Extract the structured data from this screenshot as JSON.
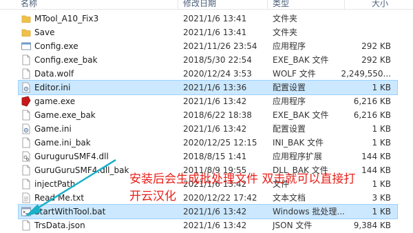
{
  "columns": {
    "name": "名称",
    "date": "修改日期",
    "type": "类型",
    "size": "大小"
  },
  "files": [
    {
      "name": "MTool_A10_Fix3",
      "date": "2021/1/6 13:41",
      "type": "文件夹",
      "size": "",
      "icon": "folder-icon"
    },
    {
      "name": "Save",
      "date": "2021/1/6 13:41",
      "type": "文件夹",
      "size": "",
      "icon": "folder-icon"
    },
    {
      "name": "Config.exe",
      "date": "2021/11/26 23:54",
      "type": "应用程序",
      "size": "292 KB",
      "icon": "window-exe-icon"
    },
    {
      "name": "Config.exe_bak",
      "date": "2018/5/30 22:54",
      "type": "EXE_BAK 文件",
      "size": "292 KB",
      "icon": "file-icon"
    },
    {
      "name": "Data.wolf",
      "date": "2020/12/24 3:53",
      "type": "WOLF 文件",
      "size": "2,249,550...",
      "icon": "file-icon"
    },
    {
      "name": "Editor.ini",
      "date": "2021/1/6 13:36",
      "type": "配置设置",
      "size": "1 KB",
      "icon": "settings-file-icon",
      "selected": true
    },
    {
      "name": "game.exe",
      "date": "2021/1/6 13:42",
      "type": "应用程序",
      "size": "6,216 KB",
      "icon": "game-exe-icon"
    },
    {
      "name": "Game.exe_bak",
      "date": "2018/6/22 18:38",
      "type": "EXE_BAK 文件",
      "size": "6,216 KB",
      "icon": "file-icon"
    },
    {
      "name": "Game.ini",
      "date": "2021/1/6 13:42",
      "type": "配置设置",
      "size": "1 KB",
      "icon": "settings-file-icon"
    },
    {
      "name": "Game.ini_bak",
      "date": "2020/12/25 12:15",
      "type": "INI_BAK 文件",
      "size": "1 KB",
      "icon": "file-icon"
    },
    {
      "name": "GuruguruSMF4.dll",
      "date": "2018/8/15 1:41",
      "type": "应用程序扩展",
      "size": "144 KB",
      "icon": "dll-icon"
    },
    {
      "name": "GuruGuruSMF4.dll_bak",
      "date": "2011/8/9 19:55",
      "type": "DLL_BAK 文件",
      "size": "144 KB",
      "icon": "file-icon"
    },
    {
      "name": "injectPath",
      "date": "2021/1/6 13:42",
      "type": "文件",
      "size": "1 KB",
      "icon": "file-icon"
    },
    {
      "name": "Read Me.txt",
      "date": "2020/12/22 17:42",
      "type": "文本文档",
      "size": "3 KB",
      "icon": "text-file-icon"
    },
    {
      "name": "StartWithTool.bat",
      "date": "2021/1/6 13:42",
      "type": "Windows 批处理...",
      "size": "1 KB",
      "icon": "bat-file-icon",
      "selected": true
    },
    {
      "name": "TrsData.json",
      "date": "2021/1/6 13:42",
      "type": "JSON 文件",
      "size": "9,384 KB",
      "icon": "file-icon"
    }
  ],
  "annotation": {
    "line1": "安装后会生成批处理文件 双击就可以直接打",
    "line2": "开云汉化",
    "color": "#e8201a",
    "arrow_color": "#1ab0c8"
  }
}
